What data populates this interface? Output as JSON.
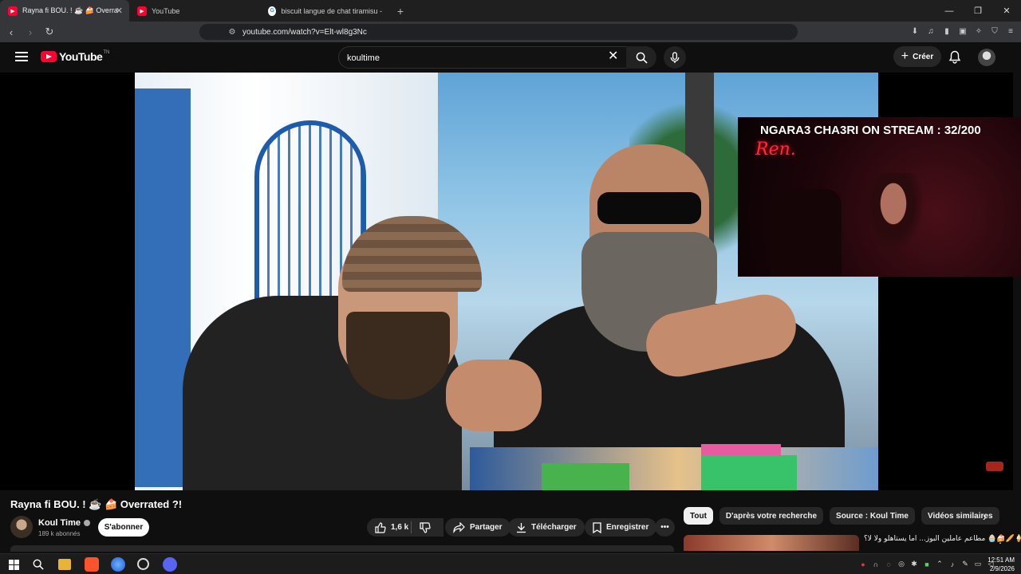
{
  "browser": {
    "tabs": [
      {
        "title": "Rayna fi BOU. ! ☕ 🍰 Overra",
        "active": true
      },
      {
        "title": "YouTube",
        "active": false
      },
      {
        "title": "biscuit langue de chat tiramisu - Goo",
        "active": false
      }
    ],
    "url": "youtube.com/watch?v=Elt-wl8g3Nc"
  },
  "youtube": {
    "logo_text": "YouTube",
    "logo_region": "TN",
    "search_value": "koultime",
    "create_label": "Créer"
  },
  "video": {
    "overlay_title": "NGARA3 CHA3RI ON STREAM : 32/200",
    "overlay_neon": "Ren.",
    "title": "Rayna fi BOU. ! ☕ 🍰 Overrated ?!",
    "channel": "Koul Time",
    "subscribers": "189 k abonnés",
    "subscribe_label": "S'abonner",
    "likes": "1,6 k",
    "share_label": "Partager",
    "download_label": "Télécharger",
    "save_label": "Enregistrer"
  },
  "chips": [
    "Tout",
    "D'après votre recherche",
    "Source : Koul Time",
    "Vidéos similaires"
  ],
  "recommendation": {
    "title": "مطاعم عاملين البوز... اما يستاهلو ولا لا؟ 🧁🍰🥖🍦"
  },
  "clock": {
    "time": "12:51 AM",
    "date": "2/9/2026"
  },
  "colors": {
    "brand_red": "#ff0033",
    "background": "#0f0f0f",
    "chip_bg": "#272727"
  }
}
